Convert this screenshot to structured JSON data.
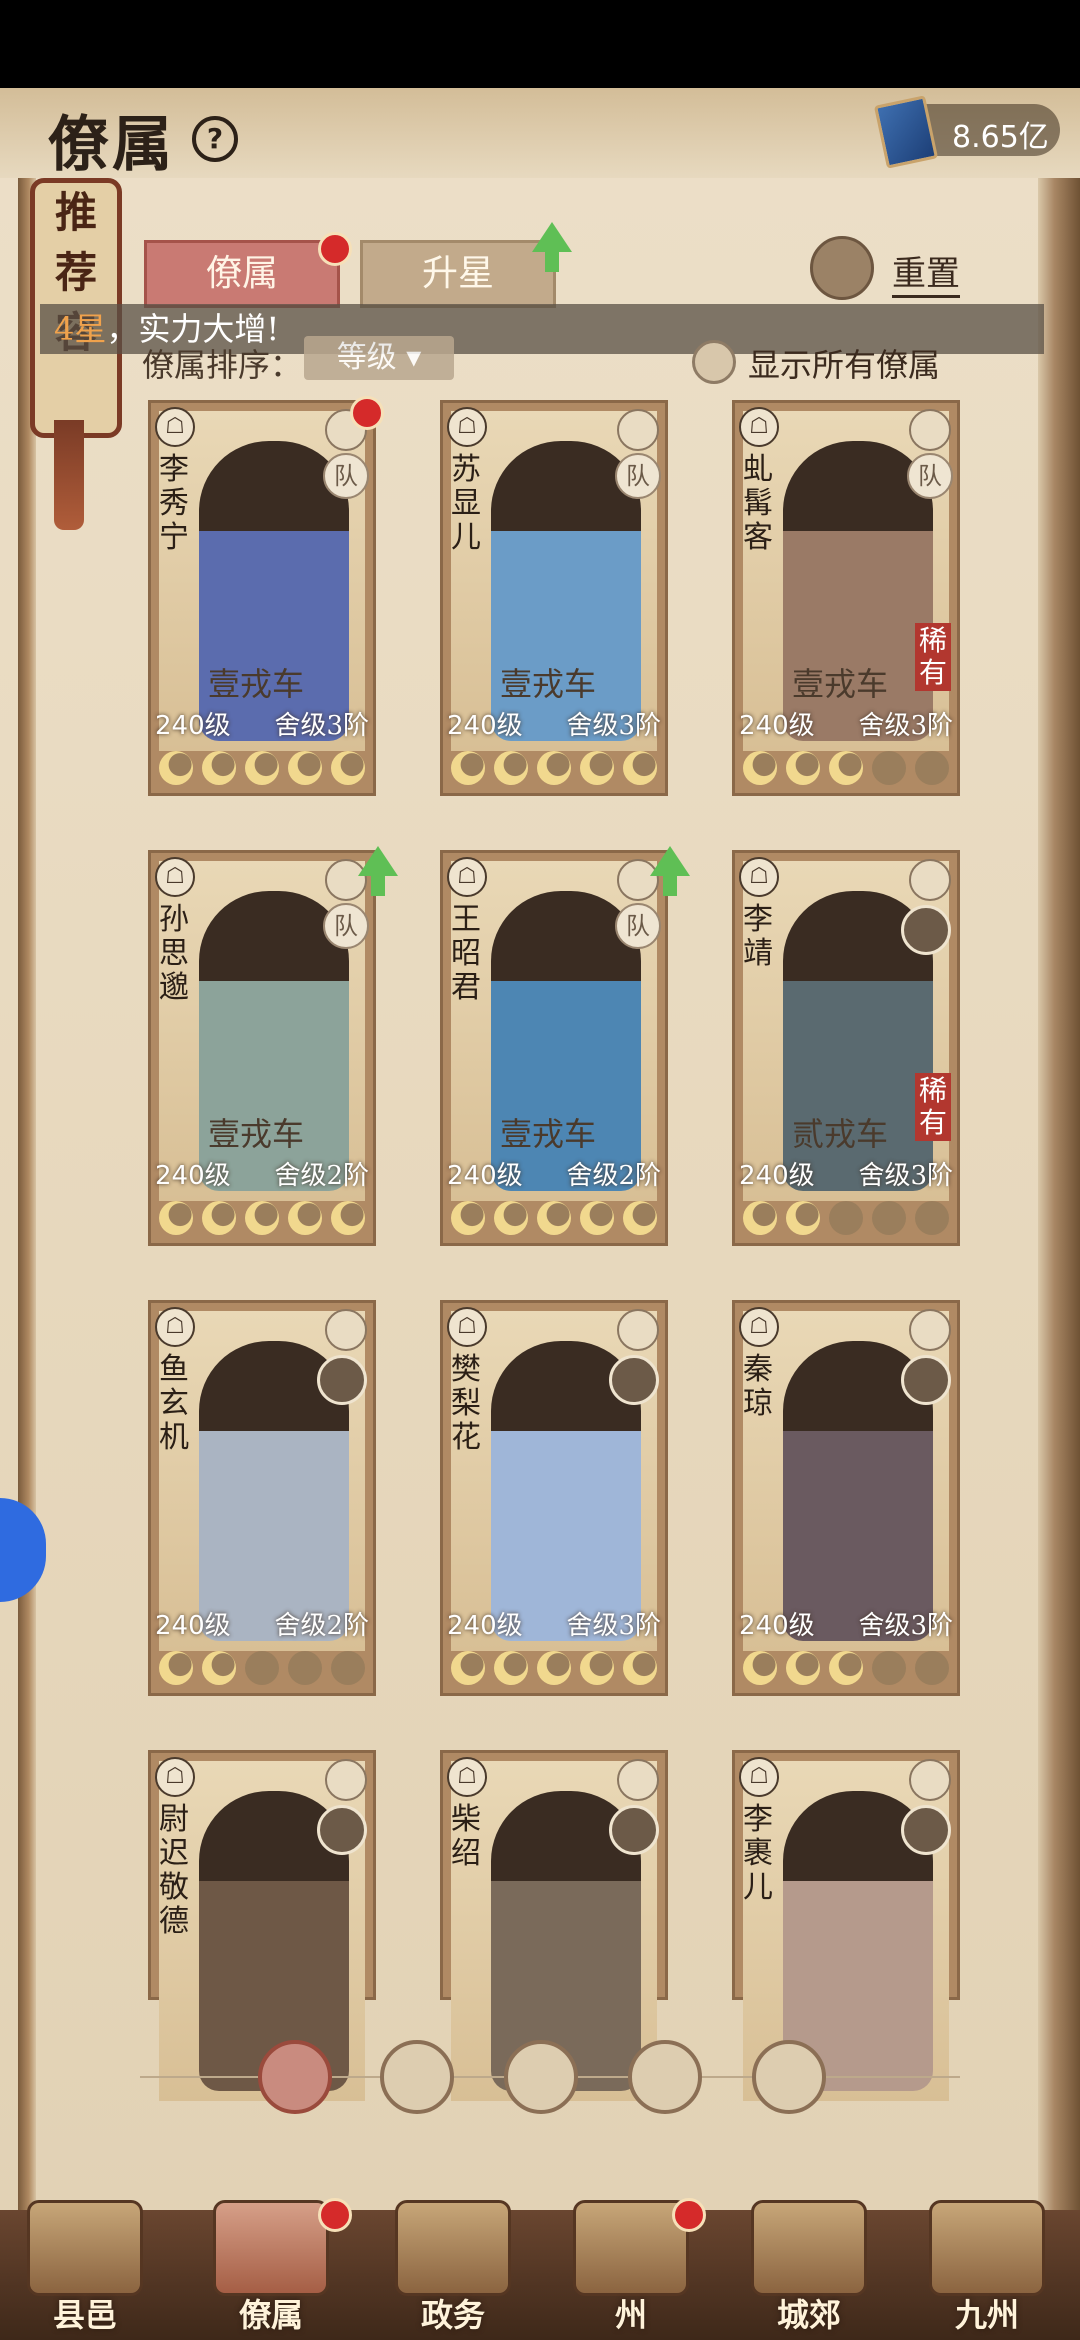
{
  "header": {
    "title": "僚属",
    "currency": "8.65亿"
  },
  "side_tab": {
    "chars": [
      "推",
      "荐",
      "容"
    ]
  },
  "tabs": [
    {
      "label": "僚属"
    },
    {
      "label": "升星"
    }
  ],
  "reset_label": "重置",
  "toast": {
    "highlight": "4星",
    "text": "，实力大增!"
  },
  "sort": {
    "label": "僚属排序：",
    "value": "等级"
  },
  "show_all_label": "显示所有僚属",
  "cards": [
    {
      "name": [
        "李",
        "秀",
        "宁"
      ],
      "vehicle": "壹戎车",
      "level": "240级",
      "rank": "舍级3阶",
      "stars": 5,
      "rare": "",
      "team": "队",
      "figure_color": "#5b6cae"
    },
    {
      "name": [
        "苏",
        "显",
        "儿"
      ],
      "vehicle": "壹戎车",
      "level": "240级",
      "rank": "舍级3阶",
      "stars": 5,
      "rare": "",
      "team": "队",
      "figure_color": "#6b9cc7"
    },
    {
      "name": [
        "虬",
        "髯",
        "客"
      ],
      "vehicle": "壹戎车",
      "level": "240级",
      "rank": "舍级3阶",
      "stars": 3,
      "rare": "稀有",
      "team": "队",
      "figure_color": "#9a7a66"
    },
    {
      "name": [
        "孙",
        "思",
        "邈"
      ],
      "vehicle": "壹戎车",
      "level": "240级",
      "rank": "舍级2阶",
      "stars": 5,
      "rare": "",
      "team": "队",
      "figure_color": "#8ca39a"
    },
    {
      "name": [
        "王",
        "昭",
        "君"
      ],
      "vehicle": "壹戎车",
      "level": "240级",
      "rank": "舍级2阶",
      "stars": 5,
      "rare": "",
      "team": "队",
      "figure_color": "#4d86b3"
    },
    {
      "name": [
        "李",
        "靖"
      ],
      "vehicle": "贰戎车",
      "level": "240级",
      "rank": "舍级3阶",
      "stars": 2,
      "rare": "稀有",
      "team": "",
      "figure_color": "#5a6a70"
    },
    {
      "name": [
        "鱼",
        "玄",
        "机"
      ],
      "vehicle": "",
      "level": "240级",
      "rank": "舍级2阶",
      "stars": 2,
      "rare": "",
      "team": "",
      "figure_color": "#aab4c2"
    },
    {
      "name": [
        "樊",
        "梨",
        "花"
      ],
      "vehicle": "",
      "level": "240级",
      "rank": "舍级3阶",
      "stars": 5,
      "rare": "",
      "team": "",
      "figure_color": "#9fb6d8"
    },
    {
      "name": [
        "秦",
        "琼"
      ],
      "vehicle": "",
      "level": "240级",
      "rank": "舍级3阶",
      "stars": 3,
      "rare": "",
      "team": "",
      "figure_color": "#6a5a60"
    },
    {
      "name": [
        "尉",
        "迟",
        "敬",
        "德"
      ],
      "vehicle": "",
      "level": "",
      "rank": "",
      "stars": 0,
      "rare": "",
      "team": "",
      "figure_color": "#6e5846"
    },
    {
      "name": [
        "柴",
        "绍"
      ],
      "vehicle": "",
      "level": "",
      "rank": "",
      "stars": 0,
      "rare": "",
      "team": "",
      "figure_color": "#7a6a5a"
    },
    {
      "name": [
        "李",
        "裹",
        "儿"
      ],
      "vehicle": "",
      "level": "",
      "rank": "",
      "stars": 0,
      "rare": "",
      "team": "",
      "figure_color": "#b59a8c"
    }
  ],
  "nav": [
    {
      "label": "县邑"
    },
    {
      "label": "僚属"
    },
    {
      "label": "政务"
    },
    {
      "label": "州"
    },
    {
      "label": "城郊"
    },
    {
      "label": "九州"
    }
  ]
}
